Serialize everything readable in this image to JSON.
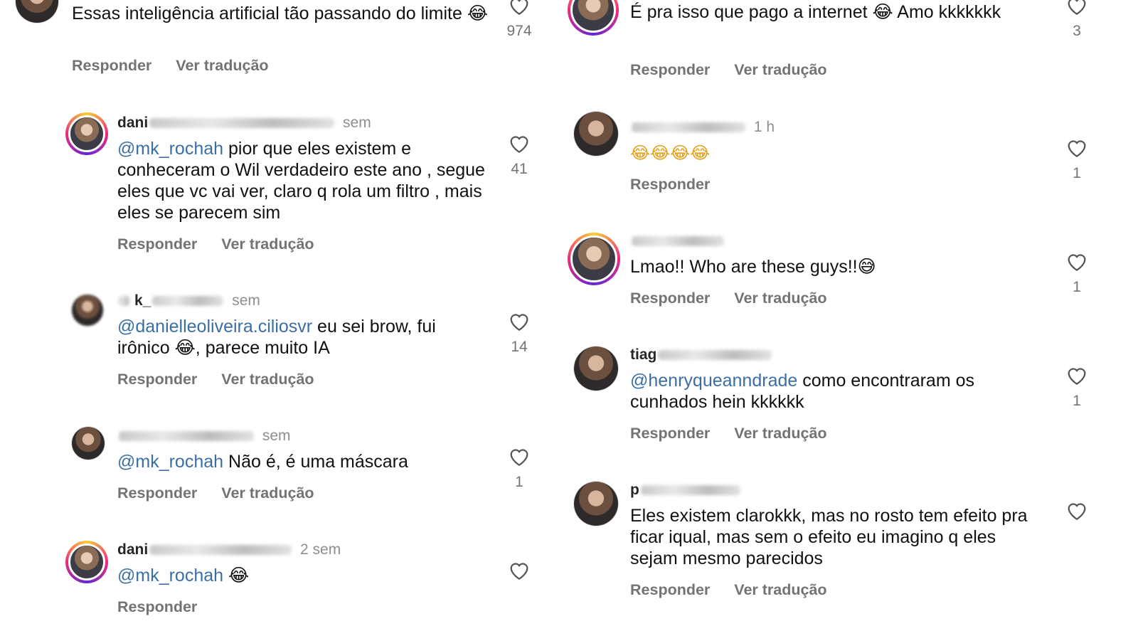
{
  "left": [
    {
      "meta_user": "",
      "meta_time": "",
      "mention": "",
      "text": "Essas inteligência artificial tão passando do limite 😂",
      "actions": [
        "Responder",
        "Ver tradução"
      ],
      "likes": "974"
    },
    {
      "meta_user": "dani",
      "meta_time": "sem",
      "mention": "@mk_rochah",
      "text": " pior que eles existem e conheceram o Wil verdadeiro este ano , segue eles que vc vai ver, claro q rola um filtro , mais eles se parecem sim",
      "actions": [
        "Responder",
        "Ver tradução"
      ],
      "likes": "41"
    },
    {
      "meta_user": "k_",
      "meta_time": "sem",
      "mention": "@danielleoliveira.ciliosvr",
      "text": " eu sei brow, fui irônico 😂, parece muito IA",
      "actions": [
        "Responder",
        "Ver tradução"
      ],
      "likes": "14"
    },
    {
      "meta_user": "",
      "meta_time": "sem",
      "mention": "@mk_rochah",
      "text": " Não é, é uma máscara",
      "actions": [
        "Responder",
        "Ver tradução"
      ],
      "likes": "1"
    },
    {
      "meta_user": "dani",
      "meta_time": "2 sem",
      "mention": "@mk_rochah",
      "text": " 😂",
      "actions": [
        "Responder"
      ],
      "likes": ""
    }
  ],
  "right": [
    {
      "meta_user": "",
      "meta_time": "",
      "mention": "",
      "text": "É pra isso que pago a internet 😂 Amo kkkkkkk",
      "actions": [
        "Responder",
        "Ver tradução"
      ],
      "likes": "3"
    },
    {
      "meta_user": "",
      "meta_time": "1 h",
      "mention": "",
      "text": "😂😂😂😂",
      "actions": [
        "Responder"
      ],
      "likes": "1"
    },
    {
      "meta_user": "",
      "meta_time": "",
      "mention": "",
      "text": "Lmao!! Who are these guys!!😅",
      "actions": [
        "Responder",
        "Ver tradução"
      ],
      "likes": "1"
    },
    {
      "meta_user": "tiag",
      "meta_time": "",
      "mention": "@henryqueanndrade",
      "text": "  como encontraram os cunhados hein kkkkkk",
      "actions": [
        "Responder",
        "Ver tradução"
      ],
      "likes": "1"
    },
    {
      "meta_user": "p",
      "meta_time": "",
      "mention": "",
      "text": "Eles existem clarokkk, mas no rosto tem efeito pra ficar iqual, mas sem o efeito eu imagino q eles sejam mesmo parecidos",
      "actions": [
        "Responder",
        "Ver tradução"
      ],
      "likes": ""
    }
  ]
}
